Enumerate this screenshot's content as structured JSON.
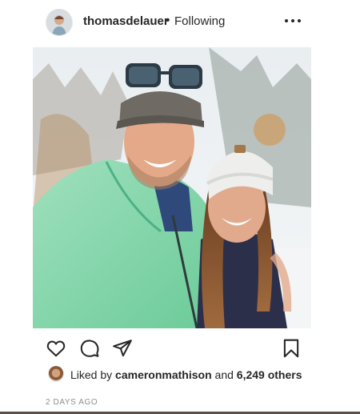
{
  "post": {
    "username": "thomasdelauer",
    "separator": "•",
    "follow_status": "Following",
    "more_icon": "ellipsis-icon",
    "image_alt": "Selfie of a man in sunglasses and cap with a woman in a white pom-pom beanie in the snow"
  },
  "actions": {
    "like_icon": "heart-icon",
    "comment_icon": "comment-icon",
    "share_icon": "send-icon",
    "save_icon": "bookmark-icon"
  },
  "likes": {
    "prefix": "Liked by",
    "user": "cameronmathison",
    "connector": "and",
    "count": "6,249 others"
  },
  "timestamp": "2 DAYS AGO"
}
